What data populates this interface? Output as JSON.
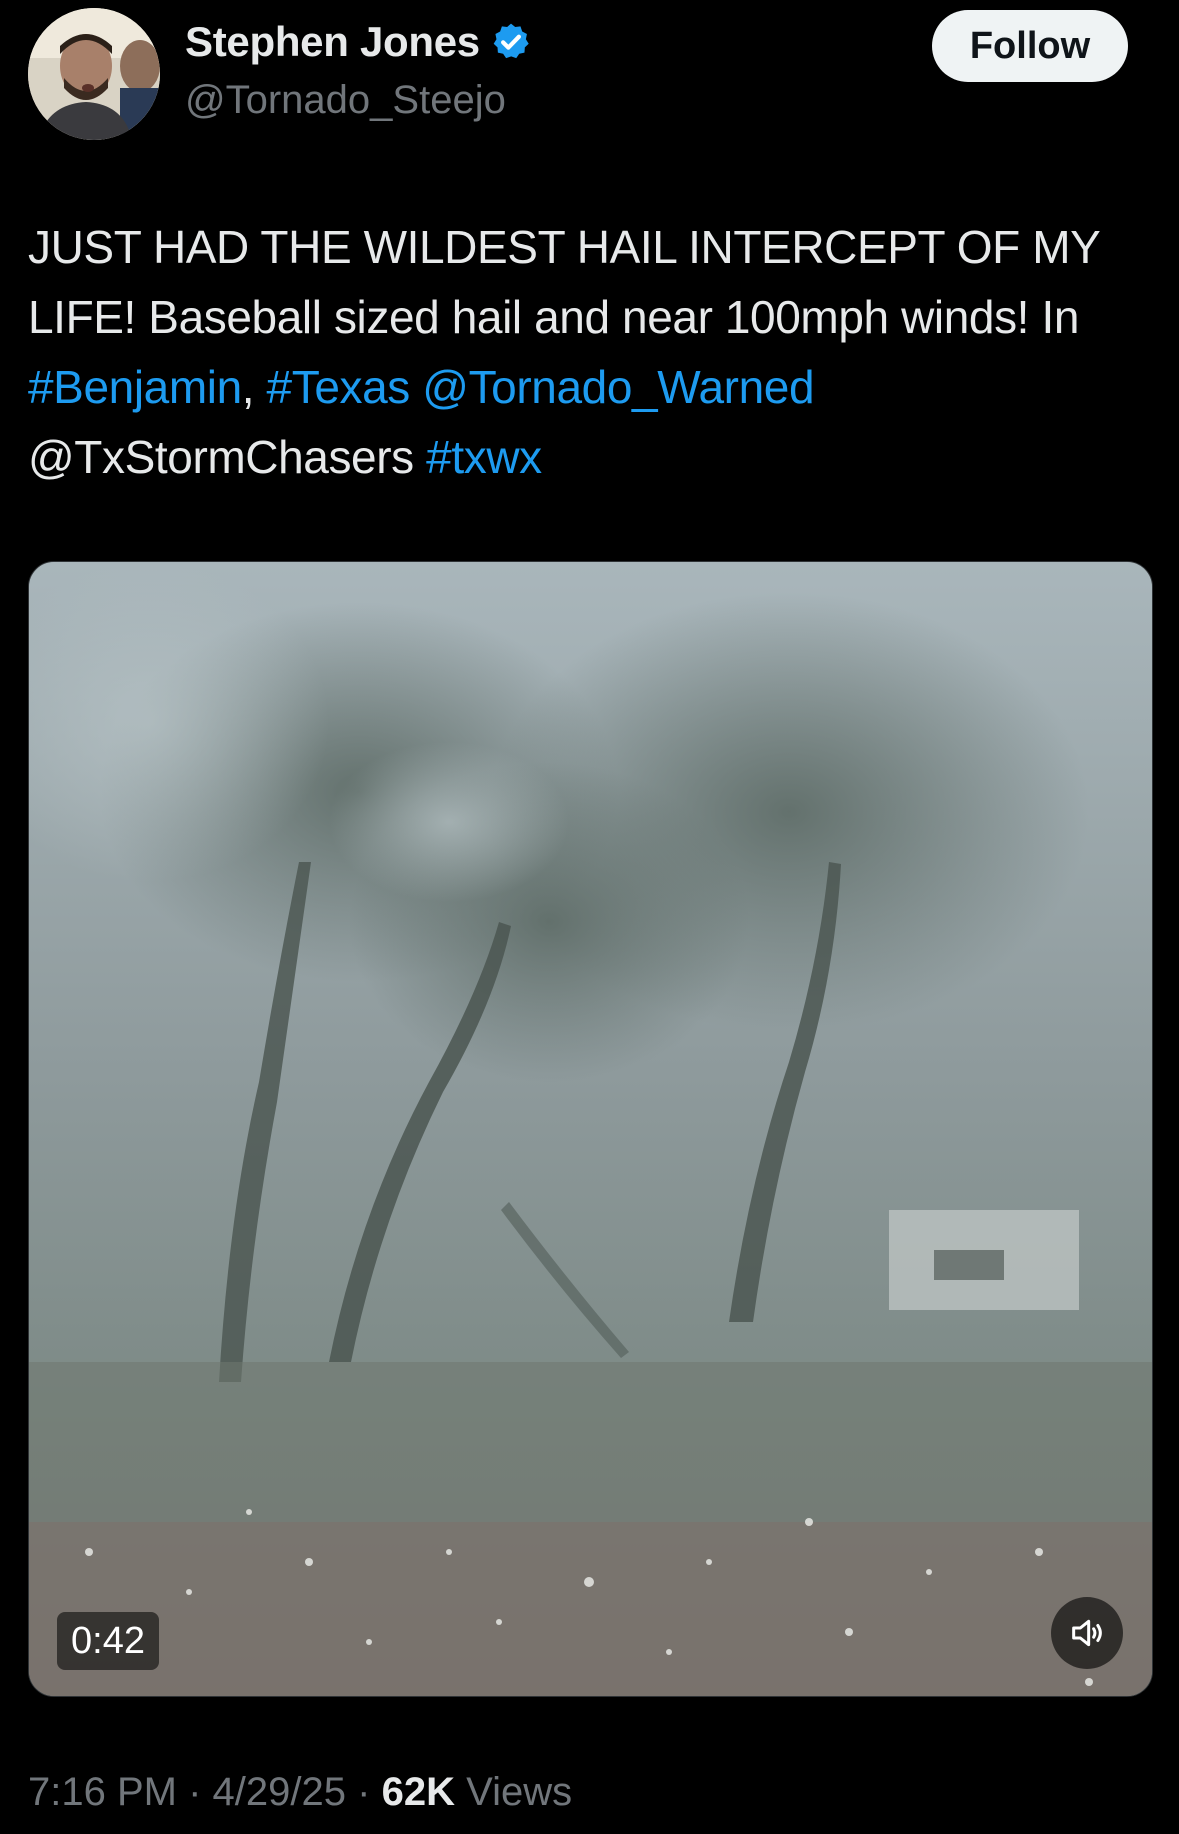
{
  "author": {
    "display_name": "Stephen Jones",
    "handle": "@Tornado_Steejo",
    "verified_icon": "verified-badge-icon",
    "verified_color": "#1d9bf0"
  },
  "follow_button": {
    "label": "Follow"
  },
  "tweet": {
    "segments": [
      {
        "text": "JUST HAD THE WILDEST HAIL INTERCEPT OF MY LIFE! Baseball sized hail and near 100mph winds! In ",
        "type": "text"
      },
      {
        "text": "#Benjamin",
        "type": "hashtag"
      },
      {
        "text": ", ",
        "type": "text"
      },
      {
        "text": "#Texas",
        "type": "hashtag"
      },
      {
        "text": " ",
        "type": "text"
      },
      {
        "text": "@Tornado_Warned",
        "type": "mention"
      },
      {
        "text": " @TxStormChasers ",
        "type": "text"
      },
      {
        "text": "#txwx",
        "type": "hashtag"
      }
    ],
    "link_color": "#1d9bf0"
  },
  "media": {
    "type": "video",
    "duration": "0:42",
    "mute_icon": "speaker-muted-icon"
  },
  "meta": {
    "time": "7:16 PM",
    "separator": "·",
    "date": "4/29/25",
    "views_count": "62K",
    "views_label": "Views"
  }
}
